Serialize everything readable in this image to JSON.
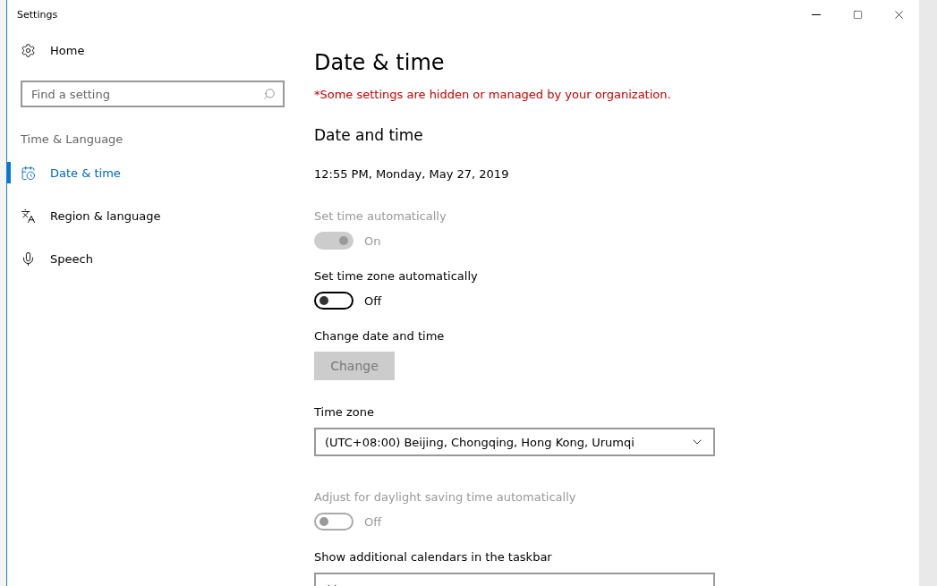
{
  "window": {
    "title": "Settings"
  },
  "sidebar": {
    "home": "Home",
    "search": {
      "placeholder": "Find a setting"
    },
    "section": "Time & Language",
    "items": [
      {
        "label": "Date & time",
        "selected": true
      },
      {
        "label": "Region & language",
        "selected": false
      },
      {
        "label": "Speech",
        "selected": false
      }
    ]
  },
  "page": {
    "title": "Date & time",
    "notice": "*Some settings are hidden or managed by your organization.",
    "section": "Date and time",
    "current_time": "12:55 PM, Monday, May 27, 2019",
    "settings": [
      {
        "kind": "toggle",
        "label": "Set time automatically",
        "on": true,
        "disabled": true,
        "state_text": "On"
      },
      {
        "kind": "toggle",
        "label": "Set time zone automatically",
        "on": false,
        "disabled": false,
        "state_text": "Off"
      },
      {
        "kind": "button",
        "label": "Change date and time",
        "button": "Change",
        "disabled": true
      },
      {
        "kind": "dropdown",
        "label": "Time zone",
        "value": "(UTC+08:00) Beijing, Chongqing, Hong Kong, Urumqi"
      },
      {
        "kind": "toggle",
        "label": "Adjust for daylight saving time automatically",
        "on": false,
        "disabled": true,
        "state_text": "Off"
      },
      {
        "kind": "dropdown",
        "label": "Show additional calendars in the taskbar"
      }
    ]
  }
}
